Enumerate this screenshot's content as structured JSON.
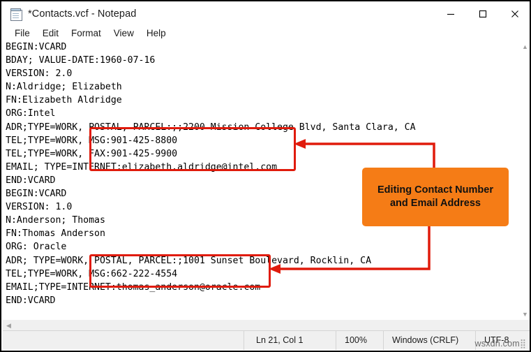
{
  "window": {
    "title": "*Contacts.vcf - Notepad",
    "icon": "notepad-icon",
    "controls": {
      "minimize": "minimize-icon",
      "maximize": "maximize-icon",
      "close": "close-icon"
    }
  },
  "menubar": {
    "items": [
      {
        "label": "File"
      },
      {
        "label": "Edit"
      },
      {
        "label": "Format"
      },
      {
        "label": "View"
      },
      {
        "label": "Help"
      }
    ]
  },
  "editor": {
    "lines": [
      "BEGIN:VCARD",
      "BDAY; VALUE-DATE:1960-07-16",
      "VERSION: 2.0",
      "N:Aldridge; Elizabeth",
      "FN:Elizabeth Aldridge",
      "ORG:Intel",
      "ADR;TYPE=WORK, POSTAL, PARCEL:;;2200 Mission College Blvd, Santa Clara, CA",
      "TEL;TYPE=WORK, MSG:901-425-8800",
      "TEL;TYPE=WORK, FAX:901-425-9900",
      "EMAIL; TYPE=INTERNET:elizabeth.aldridge@intel.com",
      "END:VCARD",
      "BEGIN:VCARD",
      "VERSION: 1.0",
      "N:Anderson; Thomas",
      "FN:Thomas Anderson",
      "ORG: Oracle",
      "ADR; TYPE=WORK, POSTAL, PARCEL:;1001 Sunset Boulevard, Rocklin, CA",
      "TEL;TYPE=WORK, MSG:662-222-4554",
      "EMAIL;TYPE=INTERNET:thomas_anderson@oracle.com",
      "END:VCARD"
    ]
  },
  "scrollbars": {
    "vertical_up": "▲",
    "vertical_down": "▼",
    "horizontal_left": "◀"
  },
  "statusbar": {
    "position": "Ln 21, Col 1",
    "zoom": "100%",
    "line_ending": "Windows (CRLF)",
    "encoding": "UTF-8",
    "watermark": "wsxdn.com"
  },
  "annotations": {
    "callout_text": "Editing Contact Number and Email Address",
    "callout_color": "#f57c16",
    "highlight_color": "#e01b0c",
    "highlight_boxes": [
      {
        "name": "elizabeth-contact-highlight"
      },
      {
        "name": "thomas-contact-highlight"
      }
    ]
  }
}
